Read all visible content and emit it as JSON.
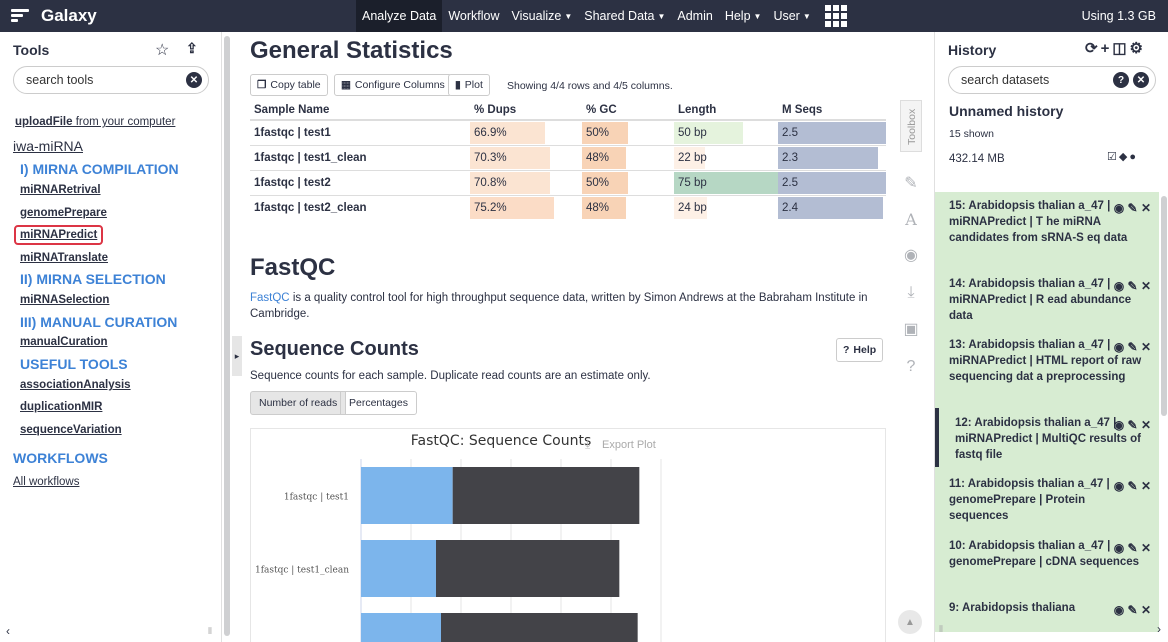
{
  "masthead": {
    "brand": "Galaxy",
    "nav": [
      {
        "label": "Analyze Data",
        "caret": false
      },
      {
        "label": "Workflow",
        "caret": false
      },
      {
        "label": "Visualize",
        "caret": true
      },
      {
        "label": "Shared Data",
        "caret": true
      },
      {
        "label": "Admin",
        "caret": false
      },
      {
        "label": "Help",
        "caret": true
      },
      {
        "label": "User",
        "caret": true
      }
    ],
    "quota": "Using 1.3 GB"
  },
  "tools": {
    "title": "Tools",
    "search_placeholder": "search tools",
    "upload_link": "uploadFile",
    "upload_suffix": " from your computer",
    "toolbox_name": "iwa-miRNA",
    "sections": [
      "I) MIRNA COMPILATION",
      "II) MIRNA SELECTION",
      "III) MANUAL CURATION",
      "USEFUL TOOLS",
      "WORKFLOWS"
    ],
    "items": [
      "miRNARetrival",
      "genomePrepare",
      "miRNAPredict",
      "miRNATranslate",
      "miRNASelection",
      "manualCuration",
      "associationAnalysis",
      "duplicationMIR",
      "sequenceVariation"
    ],
    "all_workflows": "All workflows"
  },
  "center": {
    "title": "General Statistics",
    "buttons": {
      "copy": "Copy table",
      "configure": "Configure Columns",
      "plot": "Plot"
    },
    "showing": "Showing 4/4 rows and 4/5 columns.",
    "table": {
      "headers": [
        "Sample Name",
        "% Dups",
        "% GC",
        "Length",
        "M Seqs"
      ],
      "rows": [
        {
          "name": "1fastqc | test1",
          "dups": "66.9%",
          "gc": "50%",
          "length": "50 bp",
          "mseqs": "2.5"
        },
        {
          "name": "1fastqc | test1_clean",
          "dups": "70.3%",
          "gc": "48%",
          "length": "22 bp",
          "mseqs": "2.3"
        },
        {
          "name": "1fastqc | test2",
          "dups": "70.8%",
          "gc": "50%",
          "length": "75 bp",
          "mseqs": "2.5"
        },
        {
          "name": "1fastqc | test2_clean",
          "dups": "75.2%",
          "gc": "48%",
          "length": "24 bp",
          "mseqs": "2.4"
        }
      ]
    },
    "fastqc_title": "FastQC",
    "fastqc_link": "FastQC",
    "fastqc_desc": " is a quality control tool for high throughput sequence data, written by Simon Andrews at the Babraham Institute in Cambridge.",
    "seq_title": "Sequence Counts",
    "help_btn": "Help",
    "seq_desc": "Sequence counts for each sample. Duplicate read counts are an estimate only.",
    "tabs": [
      "Number of reads",
      "Percentages"
    ],
    "export": "Export Plot",
    "toolbox_label": "Toolbox"
  },
  "chart_data": {
    "type": "bar",
    "title": "FastQC: Sequence Counts",
    "categories": [
      "1fastqc | test1",
      "1fastqc | test1_clean",
      ""
    ],
    "series": [
      {
        "name": "",
        "color": "#7cb5ec",
        "values": [
          0.55,
          0.45,
          0.48
        ]
      },
      {
        "name": "",
        "color": "#434348",
        "values": [
          1.12,
          1.1,
          1.18
        ]
      }
    ],
    "orientation": "horizontal"
  },
  "history": {
    "title": "History",
    "search_placeholder": "search datasets",
    "name": "Unnamed history",
    "shown": "15 shown",
    "size": "432.14 MB",
    "items": [
      {
        "title": "15: Arabidopsis thalian a_47 | miRNAPredict | T he miRNA candidates from sRNA-S eq data"
      },
      {
        "title": "14: Arabidopsis thalian a_47 | miRNAPredict | R ead abundance data"
      },
      {
        "title": "13: Arabidopsis thalian a_47 | miRNAPredict | HTML report of raw sequencing dat a preprocessing"
      },
      {
        "title": "12: Arabidopsis thalian a_47 | miRNAPredict | MultiQC results of fastq file"
      },
      {
        "title": "11: Arabidopsis thalian a_47 | genomePrepare | Protein sequences"
      },
      {
        "title": "10: Arabidopsis thalian a_47 | genomePrepare | cDNA sequences"
      },
      {
        "title": "9: Arabidopsis thaliana"
      }
    ]
  }
}
